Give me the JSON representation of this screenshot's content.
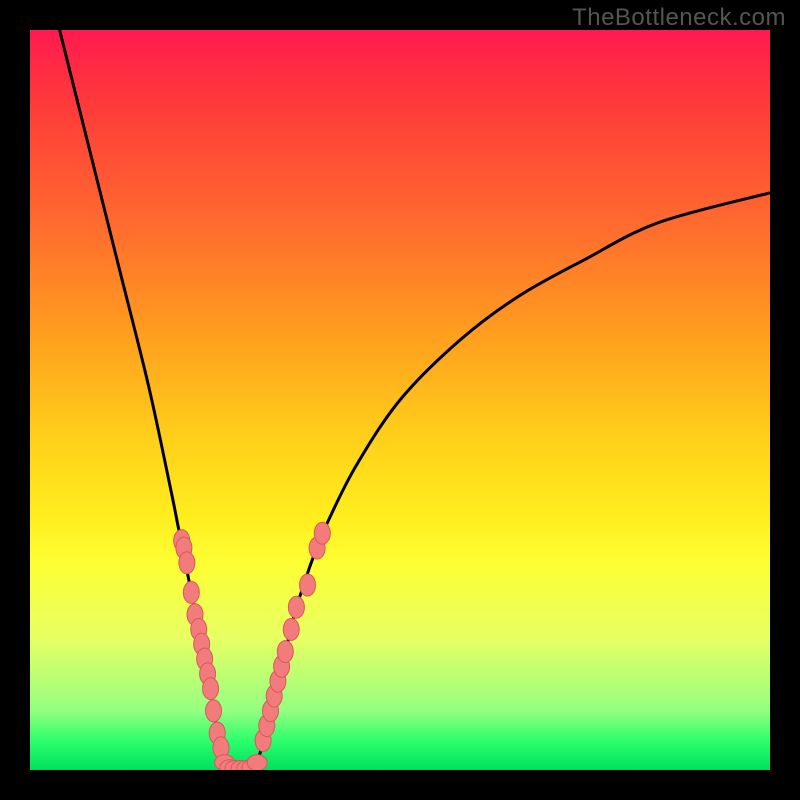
{
  "watermark": "TheBottleneck.com",
  "colors": {
    "frame": "#000000",
    "curve": "#000000",
    "marker_fill": "#f27b7b",
    "marker_stroke": "#d85a5a",
    "gradient_top": "#ff1a4f",
    "gradient_bottom": "#00e060"
  },
  "chart_data": {
    "type": "line",
    "title": "",
    "xlabel": "",
    "ylabel": "",
    "xlim": [
      0,
      100
    ],
    "ylim": [
      0,
      100
    ],
    "grid": false,
    "curve_note": "V-shaped bottleneck curve; minimum near x≈26–31, y≈0. Left branch rises to y≈100 at x≈0; right branch rises to y≈78 at x≈100.",
    "curve": [
      {
        "x": 4,
        "y": 100
      },
      {
        "x": 8,
        "y": 84
      },
      {
        "x": 12,
        "y": 68
      },
      {
        "x": 16,
        "y": 52
      },
      {
        "x": 19,
        "y": 38
      },
      {
        "x": 20,
        "y": 33
      },
      {
        "x": 21,
        "y": 28
      },
      {
        "x": 22,
        "y": 23
      },
      {
        "x": 23,
        "y": 18
      },
      {
        "x": 24,
        "y": 13
      },
      {
        "x": 25,
        "y": 7
      },
      {
        "x": 26,
        "y": 2
      },
      {
        "x": 27,
        "y": 0
      },
      {
        "x": 28,
        "y": 0
      },
      {
        "x": 29,
        "y": 0
      },
      {
        "x": 30,
        "y": 0
      },
      {
        "x": 31,
        "y": 2
      },
      {
        "x": 32,
        "y": 6
      },
      {
        "x": 33,
        "y": 10
      },
      {
        "x": 34,
        "y": 14
      },
      {
        "x": 35,
        "y": 18
      },
      {
        "x": 36,
        "y": 22
      },
      {
        "x": 37,
        "y": 25
      },
      {
        "x": 38,
        "y": 28
      },
      {
        "x": 40,
        "y": 33
      },
      {
        "x": 44,
        "y": 41
      },
      {
        "x": 50,
        "y": 50
      },
      {
        "x": 58,
        "y": 58
      },
      {
        "x": 66,
        "y": 64
      },
      {
        "x": 75,
        "y": 69
      },
      {
        "x": 85,
        "y": 74
      },
      {
        "x": 100,
        "y": 78
      }
    ],
    "markers_left": [
      {
        "x": 20.5,
        "y": 31
      },
      {
        "x": 20.8,
        "y": 30
      },
      {
        "x": 21.2,
        "y": 28
      },
      {
        "x": 21.8,
        "y": 24
      },
      {
        "x": 22.3,
        "y": 21
      },
      {
        "x": 22.8,
        "y": 19
      },
      {
        "x": 23.2,
        "y": 17
      },
      {
        "x": 23.6,
        "y": 15
      },
      {
        "x": 24.0,
        "y": 13
      },
      {
        "x": 24.4,
        "y": 11
      },
      {
        "x": 24.8,
        "y": 8
      },
      {
        "x": 25.3,
        "y": 5
      },
      {
        "x": 25.8,
        "y": 3
      }
    ],
    "markers_bottom": [
      {
        "x": 26.3,
        "y": 1
      },
      {
        "x": 27.0,
        "y": 0.3
      },
      {
        "x": 27.7,
        "y": 0.2
      },
      {
        "x": 28.5,
        "y": 0.2
      },
      {
        "x": 29.3,
        "y": 0.2
      },
      {
        "x": 30.0,
        "y": 0.3
      },
      {
        "x": 30.7,
        "y": 1
      }
    ],
    "markers_right": [
      {
        "x": 31.5,
        "y": 4
      },
      {
        "x": 32.0,
        "y": 6
      },
      {
        "x": 32.5,
        "y": 8
      },
      {
        "x": 33.0,
        "y": 10
      },
      {
        "x": 33.5,
        "y": 12
      },
      {
        "x": 34.0,
        "y": 14
      },
      {
        "x": 34.5,
        "y": 16
      },
      {
        "x": 35.3,
        "y": 19
      },
      {
        "x": 36.0,
        "y": 22
      },
      {
        "x": 37.5,
        "y": 25
      },
      {
        "x": 38.8,
        "y": 30
      },
      {
        "x": 39.5,
        "y": 32
      }
    ]
  }
}
